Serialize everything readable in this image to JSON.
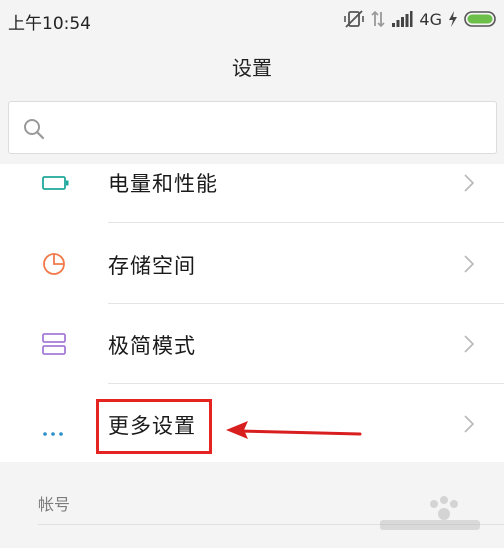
{
  "status_bar": {
    "time": "上午10:54",
    "network": "4G"
  },
  "header": {
    "title": "设置"
  },
  "search": {
    "placeholder": ""
  },
  "settings_list": {
    "items": [
      {
        "label": "电量和性能",
        "icon": "battery-icon",
        "icon_color": "#1fa89a"
      },
      {
        "label": "存储空间",
        "icon": "storage-pie-icon",
        "icon_color": "#f07a4a"
      },
      {
        "label": "极简模式",
        "icon": "simple-mode-icon",
        "icon_color": "#a67bd6"
      },
      {
        "label": "更多设置",
        "icon": "more-dots-icon",
        "icon_color": "#2a8fc9"
      }
    ]
  },
  "account_section": {
    "header": "帐号"
  },
  "annotation": {
    "highlight_color": "#e52320"
  }
}
